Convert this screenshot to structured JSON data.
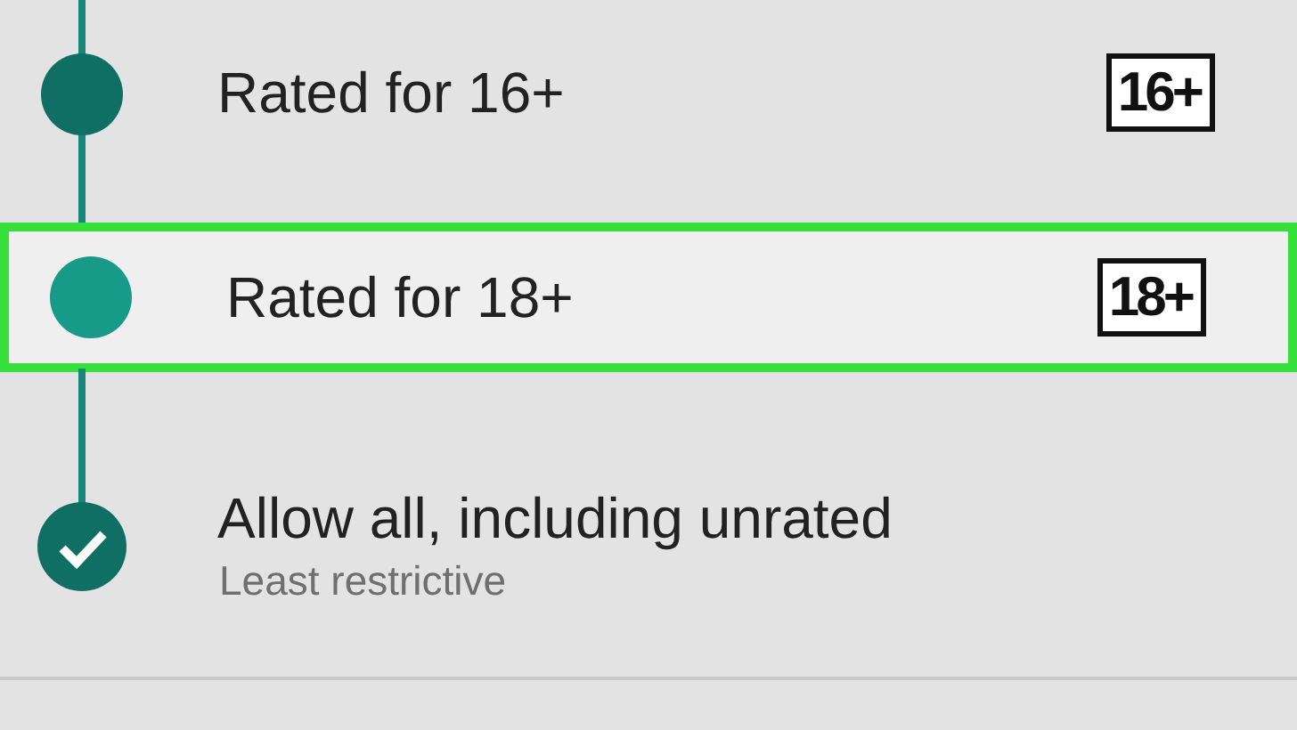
{
  "options": [
    {
      "kind": "rating",
      "label": "Rated for 16+",
      "badge": "16+",
      "selected": false,
      "highlighted": false
    },
    {
      "kind": "rating",
      "label": "Rated for 18+",
      "badge": "18+",
      "selected": false,
      "highlighted": true
    },
    {
      "kind": "allow-all",
      "label": "Allow all, including unrated",
      "subtitle": "Least restrictive",
      "selected": true,
      "highlighted": false
    }
  ]
}
